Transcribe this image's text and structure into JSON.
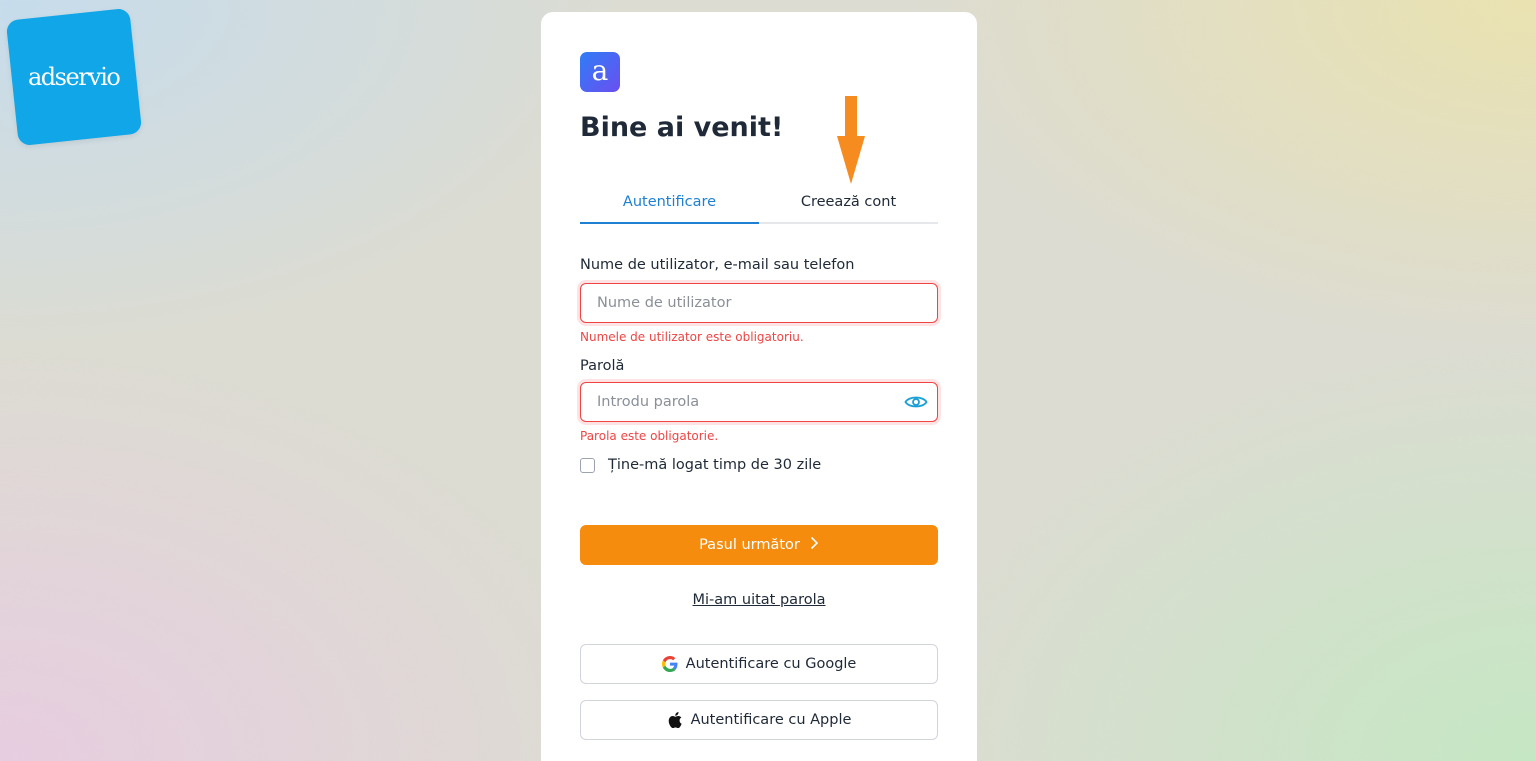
{
  "brand": {
    "name": "adservio",
    "color": "#10a6e8"
  },
  "login": {
    "app_logo_letter": "a",
    "title": "Bine ai venit!",
    "tabs": [
      {
        "label": "Autentificare",
        "active": true
      },
      {
        "label": "Creează cont",
        "active": false
      }
    ],
    "username": {
      "label": "Nume de utilizator, e-mail sau telefon",
      "placeholder": "Nume de utilizator",
      "value": "",
      "error": "Numele de utilizator este obligatoriu."
    },
    "password": {
      "label": "Parolă",
      "placeholder": "Introdu parola",
      "value": "",
      "error": "Parola este obligatorie.",
      "toggle_icon": "eye-icon"
    },
    "remember": {
      "label": "Ține-mă logat timp de 30 zile",
      "checked": false
    },
    "submit_label": "Pasul următor",
    "forgot_label": "Mi-am uitat parola",
    "social": {
      "google_label": "Autentificare cu Google",
      "apple_label": "Autentificare cu Apple"
    }
  },
  "colors": {
    "accent": "#f68c0d",
    "tab_active": "#1f7fd1",
    "error": "#ef4444",
    "arrow": "#f68c1f"
  }
}
